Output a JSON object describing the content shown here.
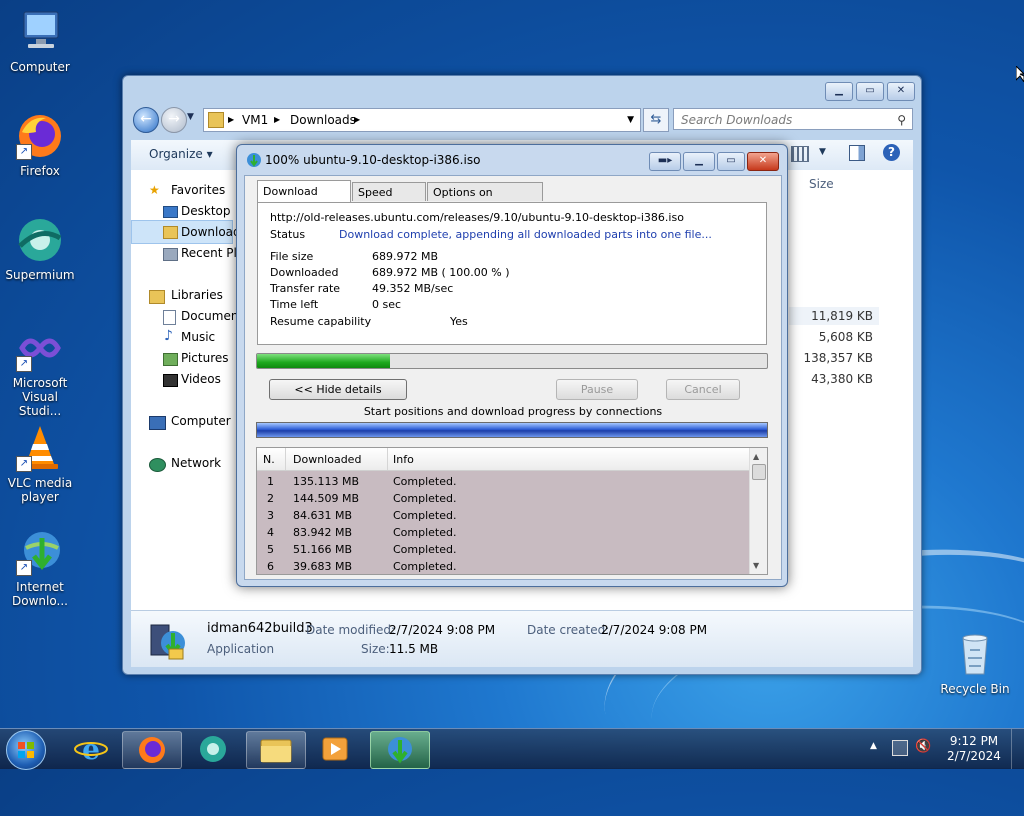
{
  "desktop": {
    "icons": [
      {
        "label": "Computer"
      },
      {
        "label": "Firefox"
      },
      {
        "label": "Supermium"
      },
      {
        "label": "Microsoft Visual Studi..."
      },
      {
        "label": "VLC media player"
      },
      {
        "label": "Internet Downlo..."
      },
      {
        "label": "Recycle Bin"
      }
    ]
  },
  "explorer": {
    "breadcrumb": [
      "VM1",
      "Downloads"
    ],
    "search_placeholder": "Search Downloads",
    "organize_label": "Organize",
    "column_size": "Size",
    "nav": {
      "favorites": "Favorites",
      "desktop": "Desktop",
      "downloads": "Download",
      "recent": "Recent Pla",
      "libraries": "Libraries",
      "documents": "Document",
      "music": "Music",
      "pictures": "Pictures",
      "videos": "Videos",
      "computer": "Computer",
      "network": "Network"
    },
    "sizes": [
      "11,819 KB",
      "5,608 KB",
      "138,357 KB",
      "43,380 KB"
    ],
    "details": {
      "name": "idman642build3",
      "type": "Application",
      "date_modified_label": "Date modified:",
      "date_modified": "2/7/2024 9:08 PM",
      "date_created_label": "Date created:",
      "date_created": "2/7/2024 9:08 PM",
      "size_label": "Size:",
      "size": "11.5 MB"
    }
  },
  "idm": {
    "title": "100% ubuntu-9.10-desktop-i386.iso",
    "tabs": [
      "Download status",
      "Speed Limiter",
      "Options on completion"
    ],
    "url": "http://old-releases.ubuntu.com/releases/9.10/ubuntu-9.10-desktop-i386.iso",
    "status_label": "Status",
    "status_value": "Download complete, appending all downloaded parts into one file...",
    "file_size_label": "File size",
    "file_size": "689.972  MB",
    "downloaded_label": "Downloaded",
    "downloaded": "689.972  MB  ( 100.00 % )",
    "transfer_rate_label": "Transfer rate",
    "transfer_rate": "49.352  MB/sec",
    "time_left_label": "Time left",
    "time_left": "0 sec",
    "resume_label": "Resume capability",
    "resume_value": "Yes",
    "progress_fraction": 0.26,
    "hide_details_label": "<< Hide details",
    "pause_label": "Pause",
    "cancel_label": "Cancel",
    "connections_caption": "Start positions and download progress by connections",
    "table_headers": [
      "N.",
      "Downloaded",
      "Info"
    ],
    "connections": [
      {
        "n": "1",
        "downloaded": "135.113  MB",
        "info": "Completed."
      },
      {
        "n": "2",
        "downloaded": "144.509  MB",
        "info": "Completed."
      },
      {
        "n": "3",
        "downloaded": "84.631  MB",
        "info": "Completed."
      },
      {
        "n": "4",
        "downloaded": "83.942  MB",
        "info": "Completed."
      },
      {
        "n": "5",
        "downloaded": "51.166  MB",
        "info": "Completed."
      },
      {
        "n": "6",
        "downloaded": "39.683  MB",
        "info": "Completed."
      }
    ]
  },
  "taskbar": {
    "time": "9:12 PM",
    "date": "2/7/2024"
  }
}
